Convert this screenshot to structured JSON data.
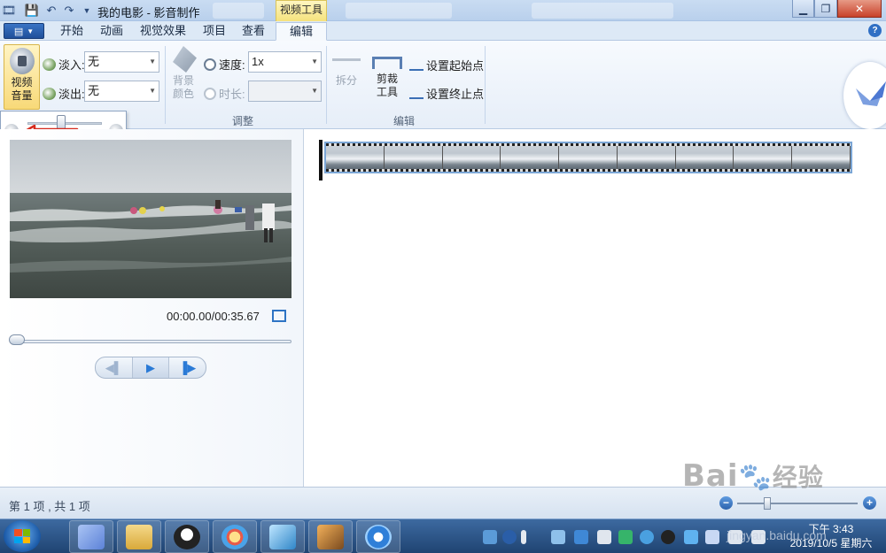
{
  "window": {
    "title": "我的电影 - 影音制作",
    "context_tab": "视频工具"
  },
  "tabs": [
    {
      "label": "开始"
    },
    {
      "label": "动画"
    },
    {
      "label": "视觉效果"
    },
    {
      "label": "项目"
    },
    {
      "label": "查看"
    },
    {
      "label": "编辑",
      "active": true
    }
  ],
  "ribbon": {
    "audio": {
      "volume_button": "视频\n音量",
      "fade_in_label": "淡入:",
      "fade_in_value": "无",
      "fade_out_label": "淡出:",
      "fade_out_value": "无"
    },
    "adjust": {
      "bg_color_label": "背景\n颜色",
      "speed_label": "速度:",
      "speed_value": "1x",
      "duration_label": "时长:",
      "duration_value": "",
      "group_label": "调整"
    },
    "edit": {
      "split_label": "拆分",
      "trim_label": "剪裁\n工具",
      "set_start": "设置起始点",
      "set_end": "设置终止点",
      "group_label": "编辑"
    }
  },
  "volume_popup": {
    "level": 0.45
  },
  "preview": {
    "time_display": "00:00.00/00:35.67",
    "seek_position": 0.0
  },
  "status": {
    "items_text": "第 1 项 , 共 1 项"
  },
  "taskbar": {
    "clock_time": "下午 3:43",
    "clock_date": "2019/10/5 星期六"
  },
  "watermark": {
    "brand": "Bai",
    "brand_cn": "经验",
    "url": "jingyan.baidu.com"
  },
  "colors": {
    "accent": "#2e74c4",
    "context_tab": "#f5e27d",
    "arrow": "#d62b1e"
  }
}
